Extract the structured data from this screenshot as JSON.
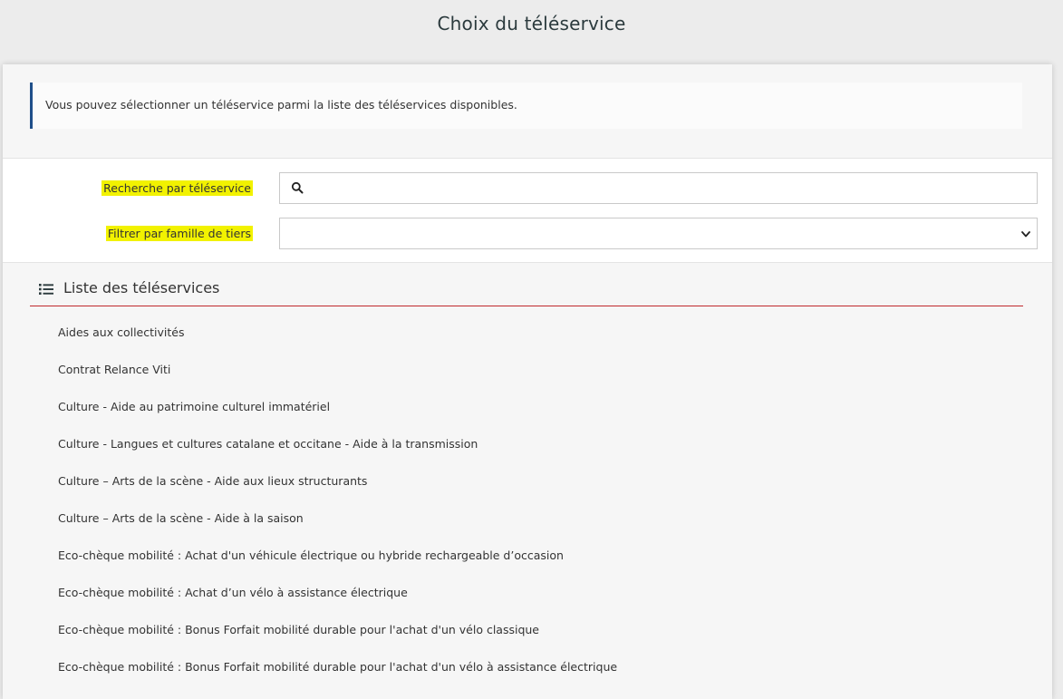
{
  "header": {
    "title": "Choix du téléservice"
  },
  "info": {
    "text": "Vous pouvez sélectionner un téléservice parmi la liste des téléservices disponibles."
  },
  "filters": {
    "search_label": "Recherche par téléservice",
    "search_value": "",
    "search_icon": "magnifier-icon",
    "family_label": "Filtrer par famille de tiers",
    "family_value": "",
    "highlight_color": "#f2f200"
  },
  "list": {
    "title": "Liste des téléservices",
    "icon": "list-icon",
    "accent_color": "#c0282d",
    "items": [
      "Aides aux collectivités",
      "Contrat Relance Viti",
      "Culture - Aide au patrimoine culturel immatériel",
      "Culture - Langues et cultures catalane et occitane - Aide à la transmission",
      "Culture – Arts de la scène - Aide aux lieux structurants",
      "Culture – Arts de la scène - Aide à la saison",
      "Eco-chèque mobilité : Achat d'un véhicule électrique ou hybride rechargeable d’occasion",
      "Eco-chèque mobilité : Achat d’un vélo à assistance électrique",
      "Eco-chèque mobilité : Bonus Forfait mobilité durable pour l'achat d'un vélo classique",
      "Eco-chèque mobilité : Bonus Forfait mobilité durable pour l'achat d'un vélo à assistance électrique"
    ]
  }
}
